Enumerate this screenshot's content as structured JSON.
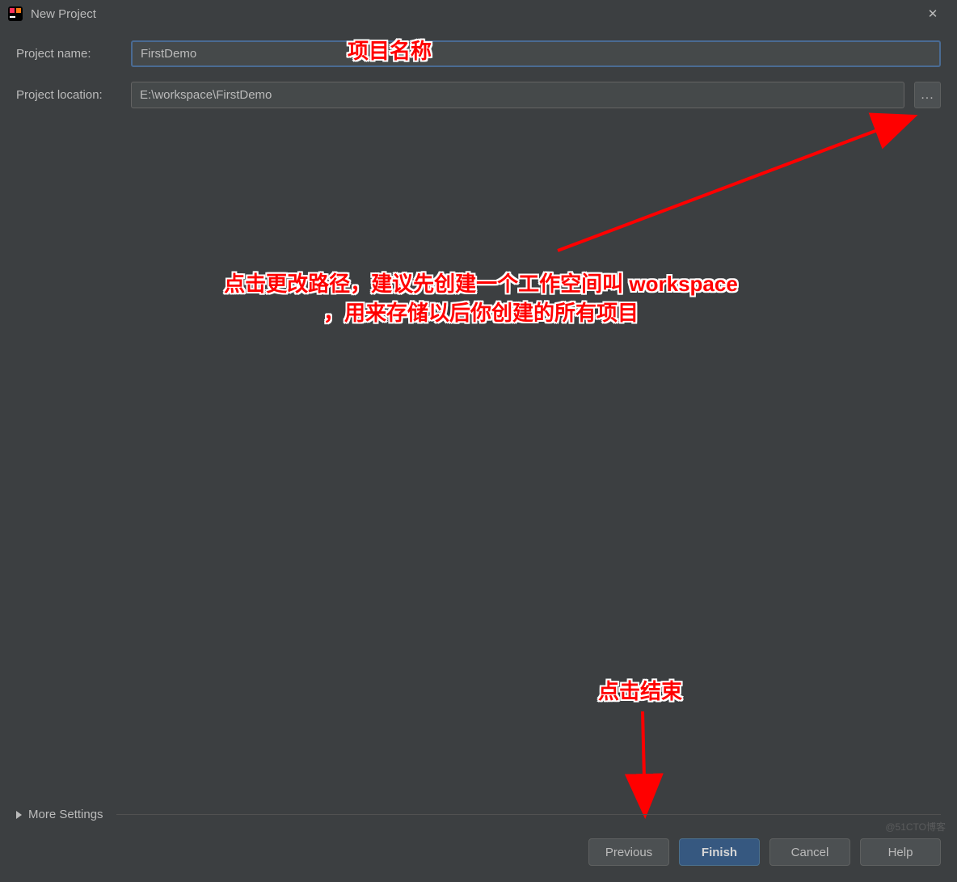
{
  "titlebar": {
    "title": "New Project",
    "close_glyph": "✕"
  },
  "form": {
    "name_label": "Project name:",
    "name_value": "FirstDemo",
    "location_label": "Project location:",
    "location_value": "E:\\workspace\\FirstDemo",
    "browse_label": "..."
  },
  "annotations": {
    "a1": "项目名称",
    "a2": "点击更改路径，建议先创建一个工作空间叫 workspace\n，用来存储以后你创建的所有项目",
    "a3": "点击结束"
  },
  "more_settings_label": "More Settings",
  "buttons": {
    "previous": "Previous",
    "finish": "Finish",
    "cancel": "Cancel",
    "help": "Help"
  },
  "watermark": "@51CTO博客"
}
